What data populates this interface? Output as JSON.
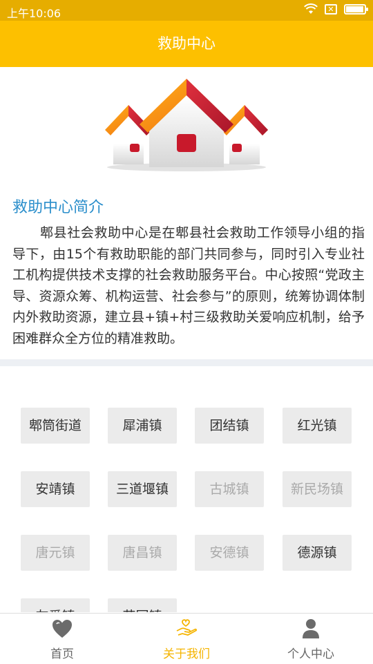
{
  "status_bar": {
    "time": "上午10:06",
    "battery_level": 0.95
  },
  "app_bar": {
    "title": "救助中心"
  },
  "intro": {
    "title": "救助中心简介",
    "body": "郫县社会救助中心是在郫县社会救助工作领导小组的指导下，由15个有救助职能的部门共同参与，同时引入专业社工机构提供技术支撑的社会救助服务平台。中心按照“党政主导、资源众筹、机构运营、社会参与”的原则，统筹协调体制内外救助资源，建立县+镇+村三级救助关爱响应机制，给予困难群众全方位的精准救助。"
  },
  "towns": [
    {
      "name": "郫筒街道",
      "enabled": true
    },
    {
      "name": "犀浦镇",
      "enabled": true
    },
    {
      "name": "团结镇",
      "enabled": true
    },
    {
      "name": "红光镇",
      "enabled": true
    },
    {
      "name": "安靖镇",
      "enabled": true
    },
    {
      "name": "三道堰镇",
      "enabled": true
    },
    {
      "name": "古城镇",
      "enabled": false
    },
    {
      "name": "新民场镇",
      "enabled": false
    },
    {
      "name": "唐元镇",
      "enabled": false
    },
    {
      "name": "唐昌镇",
      "enabled": false
    },
    {
      "name": "安德镇",
      "enabled": false
    },
    {
      "name": "德源镇",
      "enabled": true
    },
    {
      "name": "友爱镇",
      "enabled": true
    },
    {
      "name": "花园镇",
      "enabled": true
    }
  ],
  "tabbar": {
    "items": [
      {
        "label": "首页",
        "icon": "heart-icon",
        "active": false
      },
      {
        "label": "关于我们",
        "icon": "helping-hand-icon",
        "active": true
      },
      {
        "label": "个人中心",
        "icon": "person-icon",
        "active": false
      }
    ]
  },
  "colors": {
    "primary": "#fdc000",
    "status": "#e6ad00",
    "link_title": "#2a8ecb",
    "tab_active": "#f5b400"
  }
}
